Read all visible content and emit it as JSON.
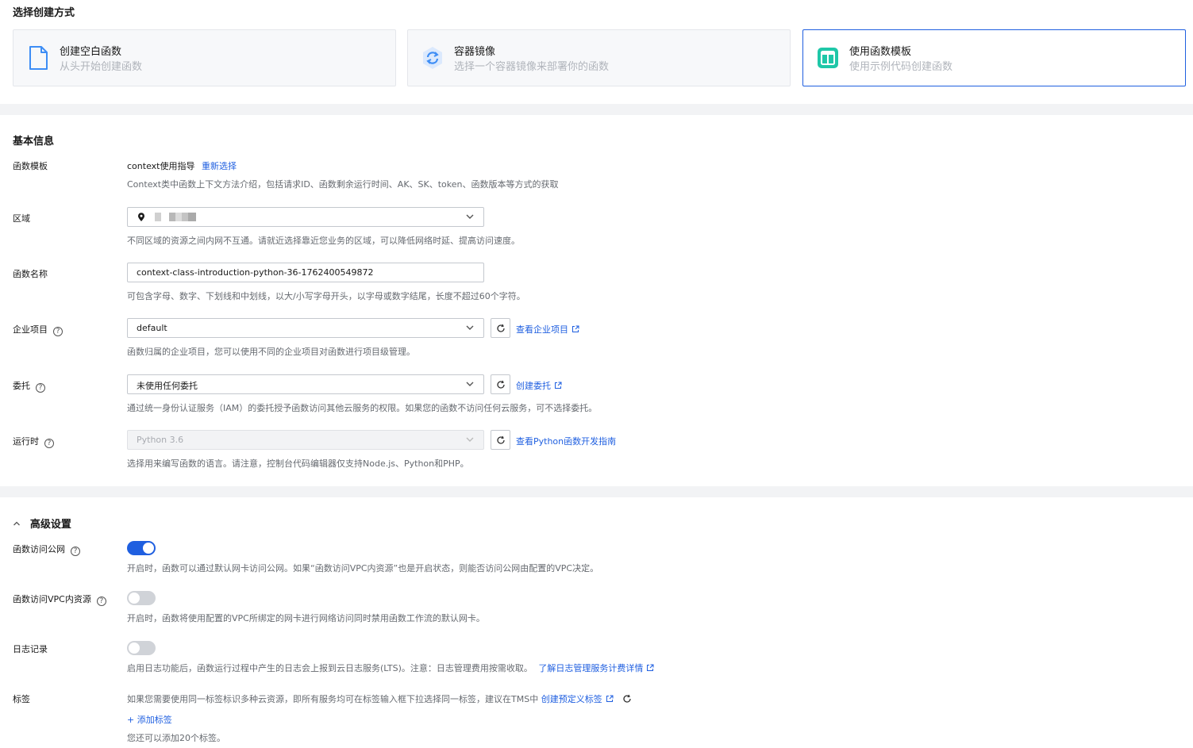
{
  "create_method": {
    "title": "选择创建方式",
    "cards": [
      {
        "title": "创建空白函数",
        "subtitle": "从头开始创建函数",
        "icon": "blank-file-icon"
      },
      {
        "title": "容器镜像",
        "subtitle": "选择一个容器镜像来部署你的函数",
        "icon": "container-image-icon"
      },
      {
        "title": "使用函数模板",
        "subtitle": "使用示例代码创建函数",
        "icon": "template-icon",
        "selected": true
      }
    ]
  },
  "basic_info": {
    "title": "基本信息",
    "template": {
      "label": "函数模板",
      "value": "context使用指导",
      "reselect_link": "重新选择",
      "hint": "Context类中函数上下文方法介绍，包括请求ID、函数剩余运行时间、AK、SK、token、函数版本等方式的获取"
    },
    "region": {
      "label": "区域",
      "hint": "不同区域的资源之间内网不互通。请就近选择靠近您业务的区域，可以降低网络时延、提高访问速度。"
    },
    "function_name": {
      "label": "函数名称",
      "value": "context-class-introduction-python-36-1762400549872",
      "hint": "可包含字母、数字、下划线和中划线，以大/小写字母开头，以字母或数字结尾，长度不超过60个字符。"
    },
    "enterprise_project": {
      "label": "企业项目",
      "value": "default",
      "link": "查看企业项目",
      "hint": "函数归属的企业项目，您可以使用不同的企业项目对函数进行项目级管理。"
    },
    "agency": {
      "label": "委托",
      "value": "未使用任何委托",
      "link": "创建委托",
      "hint": "通过统一身份认证服务（IAM）的委托授予函数访问其他云服务的权限。如果您的函数不访问任何云服务，可不选择委托。"
    },
    "runtime": {
      "label": "运行时",
      "value": "Python 3.6",
      "link": "查看Python函数开发指南",
      "hint": "选择用来编写函数的语言。请注意，控制台代码编辑器仅支持Node.js、Python和PHP。"
    }
  },
  "advanced": {
    "title": "高级设置",
    "public_access": {
      "label": "函数访问公网",
      "enabled": true,
      "hint": "开启时，函数可以通过默认网卡访问公网。如果“函数访问VPC内资源”也是开启状态，则能否访问公网由配置的VPC决定。"
    },
    "vpc_access": {
      "label": "函数访问VPC内资源",
      "enabled": false,
      "hint": "开启时，函数将使用配置的VPC所绑定的网卡进行网络访问同时禁用函数工作流的默认网卡。"
    },
    "logging": {
      "label": "日志记录",
      "enabled": false,
      "hint": "启用日志功能后，函数运行过程中产生的日志会上报到云日志服务(LTS)。注意：日志管理费用按需收取。",
      "link": "了解日志管理服务计费详情"
    },
    "tags": {
      "label": "标签",
      "hint": "如果您需要使用同一标签标识多种云资源，即所有服务均可在标签输入框下拉选择同一标签，建议在TMS中",
      "link": "创建预定义标签",
      "add_link": "+ 添加标签",
      "remaining": "您还可以添加20个标签。"
    }
  },
  "colors": {
    "accent": "#1f5fe0",
    "template_icon": "#1fc7a8"
  }
}
